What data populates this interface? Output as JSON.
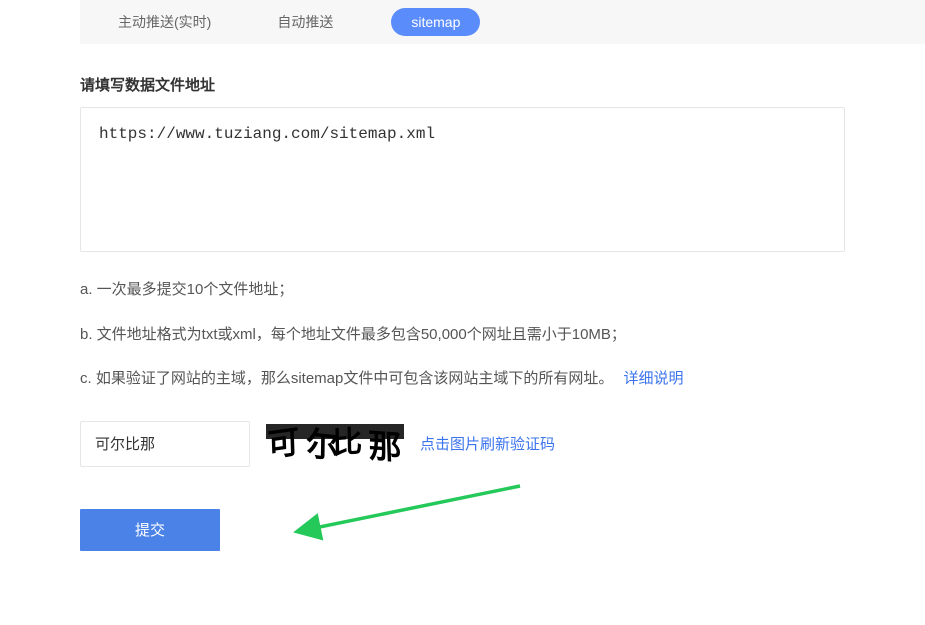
{
  "tabs": [
    {
      "label": "主动推送(实时)",
      "active": false
    },
    {
      "label": "自动推送",
      "active": false
    },
    {
      "label": "sitemap",
      "active": true
    }
  ],
  "section_title": "请填写数据文件地址",
  "url_textarea_value": "https://www.tuziang.com/sitemap.xml",
  "hints": [
    "a. 一次最多提交10个文件地址；",
    "b. 文件地址格式为txt或xml，每个地址文件最多包含50,000个网址且需小于10MB；",
    "c. 如果验证了网站的主域，那么sitemap文件中可包含该网站主域下的所有网址。"
  ],
  "hint_link_label": "详细说明",
  "captcha": {
    "input_value": "可尔比那",
    "refresh_label": "点击图片刷新验证码",
    "image_text": "可尔比那"
  },
  "submit_label": "提交"
}
